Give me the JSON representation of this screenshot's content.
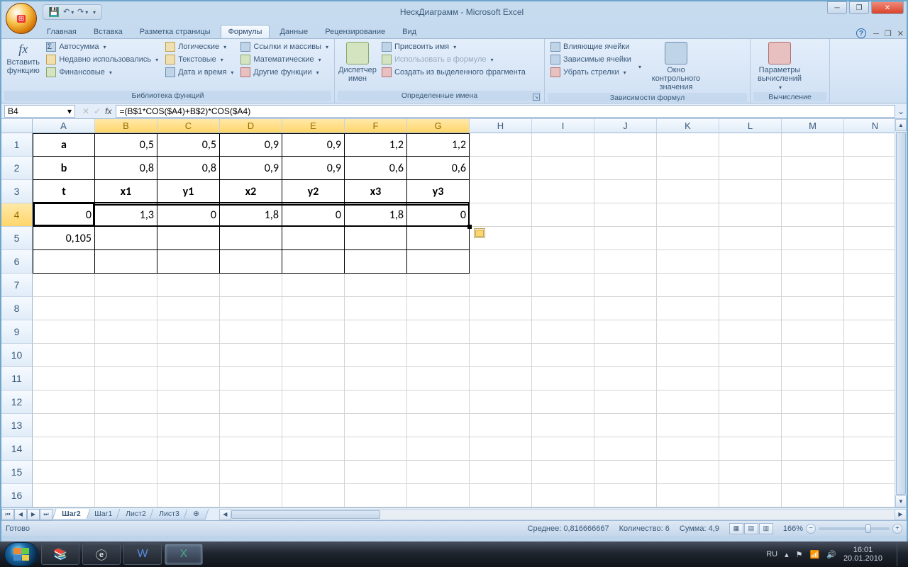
{
  "title": "НескДиаграмм - Microsoft Excel",
  "tabs": [
    "Главная",
    "Вставка",
    "Разметка страницы",
    "Формулы",
    "Данные",
    "Рецензирование",
    "Вид"
  ],
  "activeTab": "Формулы",
  "ribbon": {
    "insertFn": {
      "big": "Вставить функцию",
      "lib": [
        "Автосумма",
        "Недавно использовались",
        "Финансовые",
        "Логические",
        "Текстовые",
        "Дата и время",
        "Ссылки и массивы",
        "Математические",
        "Другие функции"
      ],
      "group": "Библиотека функций"
    },
    "names": {
      "big": "Диспетчер имен",
      "items": [
        "Присвоить имя",
        "Использовать в формуле",
        "Создать из выделенного фрагмента"
      ],
      "group": "Определенные имена"
    },
    "audit": {
      "items": [
        "Влияющие ячейки",
        "Зависимые ячейки",
        "Убрать стрелки"
      ],
      "big": "Окно контрольного значения",
      "group": "Зависимости формул"
    },
    "calc": {
      "big": "Параметры вычислений",
      "group": "Вычисление"
    }
  },
  "nameBox": "B4",
  "formula": "=(B$1*COS($A4)+B$2)*COS($A4)",
  "cols": [
    "A",
    "B",
    "C",
    "D",
    "E",
    "F",
    "G",
    "H",
    "I",
    "J",
    "K",
    "L",
    "M",
    "N"
  ],
  "rows": [
    "1",
    "2",
    "3",
    "4",
    "5",
    "6",
    "7",
    "8",
    "9",
    "10",
    "11",
    "12",
    "13",
    "14",
    "15",
    "16"
  ],
  "cells": {
    "A1": "a",
    "B1": "0,5",
    "C1": "0,5",
    "D1": "0,9",
    "E1": "0,9",
    "F1": "1,2",
    "G1": "1,2",
    "A2": "b",
    "B2": "0,8",
    "C2": "0,8",
    "D2": "0,9",
    "E2": "0,9",
    "F2": "0,6",
    "G2": "0,6",
    "A3": "t",
    "B3": "x1",
    "C3": "y1",
    "D3": "x2",
    "E3": "y2",
    "F3": "x3",
    "G3": "y3",
    "A4": "0",
    "B4": "1,3",
    "C4": "0",
    "D4": "1,8",
    "E4": "0",
    "F4": "1,8",
    "G4": "0",
    "A5": "0,105"
  },
  "sheetTabs": [
    "Шаг2",
    "Шаг1",
    "Лист2",
    "Лист3"
  ],
  "activeSheet": "Шаг2",
  "status": {
    "ready": "Готово",
    "avg": "Среднее: 0,816666667",
    "count": "Количество: 6",
    "sum": "Сумма: 4,9",
    "zoom": "166%"
  },
  "tray": {
    "lang": "RU",
    "time": "16:01",
    "date": "20.01.2010"
  }
}
